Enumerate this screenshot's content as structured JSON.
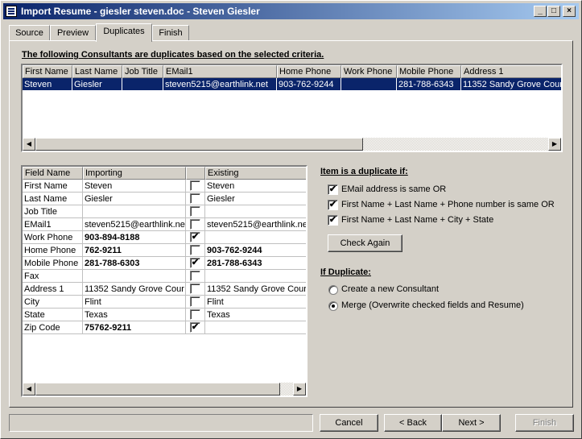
{
  "window": {
    "title": "Import Resume - giesler steven.doc - Steven Giesler",
    "minimize": "_",
    "maximize": "□",
    "close": "×"
  },
  "tabs": [
    "Source",
    "Preview",
    "Duplicates",
    "Finish"
  ],
  "duplicates": {
    "heading": "The following Consultants are duplicates based on the selected criteria.",
    "columns": [
      "First Name",
      "Last Name",
      "Job Title",
      "EMail1",
      "Home Phone",
      "Work Phone",
      "Mobile Phone",
      "Address 1"
    ],
    "rows": [
      [
        "Steven",
        "Giesler",
        "",
        "steven5215@earthlink.net",
        "903-762-9244",
        "",
        "281-788-6343",
        "11352 Sandy Grove Cour"
      ]
    ]
  },
  "fields": {
    "columns": [
      "Field Name",
      "Importing",
      "",
      "Existing"
    ],
    "rows": [
      {
        "field": "First Name",
        "importing": "Steven",
        "checked": false,
        "existing": "Steven",
        "bold": false
      },
      {
        "field": "Last Name",
        "importing": "Giesler",
        "checked": false,
        "existing": "Giesler",
        "bold": false
      },
      {
        "field": "Job Title",
        "importing": "",
        "checked": false,
        "existing": "",
        "bold": false
      },
      {
        "field": "EMail1",
        "importing": "steven5215@earthlink.ne",
        "checked": false,
        "existing": "steven5215@earthlink.ne",
        "bold": false
      },
      {
        "field": "Work Phone",
        "importing": "903-894-8188",
        "checked": true,
        "existing": "",
        "bold": true
      },
      {
        "field": "Home Phone",
        "importing": "762-9211",
        "checked": false,
        "existing": "903-762-9244",
        "bold": true
      },
      {
        "field": "Mobile Phone",
        "importing": "281-788-6303",
        "checked": true,
        "existing": "281-788-6343",
        "bold": true
      },
      {
        "field": "Fax",
        "importing": "",
        "checked": false,
        "existing": "",
        "bold": false
      },
      {
        "field": "Address 1",
        "importing": "11352 Sandy Grove Cour",
        "checked": false,
        "existing": "11352 Sandy Grove Cour",
        "bold": false
      },
      {
        "field": "City",
        "importing": "Flint",
        "checked": false,
        "existing": "Flint",
        "bold": false
      },
      {
        "field": "State",
        "importing": "Texas",
        "checked": false,
        "existing": "Texas",
        "bold": false
      },
      {
        "field": "Zip Code",
        "importing": "75762-9211",
        "checked": true,
        "existing": "",
        "bold": true
      }
    ]
  },
  "criteria": {
    "heading": "Item is a duplicate if:",
    "options": [
      {
        "label": "EMail address is same OR",
        "checked": true
      },
      {
        "label": "First Name + Last Name + Phone number is same OR",
        "checked": true
      },
      {
        "label": "First Name + Last Name + City + State",
        "checked": true
      }
    ],
    "check_again": "Check Again"
  },
  "if_duplicate": {
    "heading": "If Duplicate:",
    "options": [
      {
        "label": "Create a new Consultant",
        "selected": false
      },
      {
        "label": "Merge (Overwrite checked fields and Resume)",
        "selected": true
      }
    ]
  },
  "footer": {
    "cancel": "Cancel",
    "back": "< Back",
    "next": "Next >",
    "finish": "Finish"
  },
  "check_mark": "✔"
}
